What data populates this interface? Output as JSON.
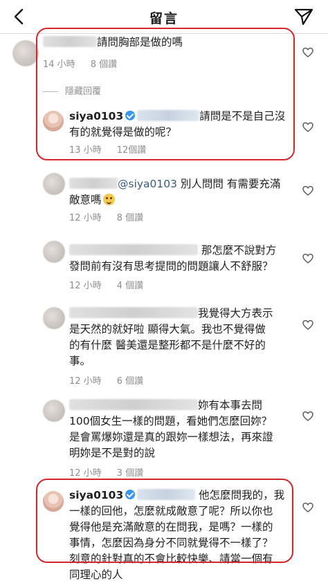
{
  "header": {
    "title": "留言"
  },
  "comments": [
    {
      "text": "請問胸部是做的嗎",
      "time": "14 小時",
      "likes": "8 個讚"
    },
    {
      "hidden_replies": "隱藏回覆"
    },
    {
      "username": "siya0103",
      "text_line1": "請問是不是自己沒",
      "text_line2": "有的就覺得是做的呢？",
      "time": "13 小時",
      "likes": "12個讚"
    },
    {
      "mention": "@siya0103",
      "text_line1": " 別人問問 有需要充滿",
      "text_line2": "敵意嗎",
      "time": "12 小時",
      "likes": "8 個讚"
    },
    {
      "text_line1": " 那怎麼不說對方",
      "text_line2": "發問前有沒有思考提問的問題讓人不舒服？",
      "time": "12 小時",
      "likes": "4 個讚"
    },
    {
      "text_line1": "我覺得大方表示",
      "text_line2": "是天然的就好啦 顯得大氣。我也不覺得做",
      "text_line3": "的有什麼 醫美還是整形都不是什麼不好的",
      "text_line4": "事。",
      "time": "12 小時",
      "likes": "6 個讚"
    },
    {
      "text_line1": "妳有本事去問",
      "text_line2": "100個女生一樣的問題，看她們怎麼回妳？",
      "text_line3": "是會罵爆妳還是真的跟妳一樣想法，再來證",
      "text_line4": "明妳是不是對的說",
      "time": "12 小時",
      "likes": "3 個讚"
    },
    {
      "username": "siya0103",
      "text_line1": " 他怎麼問我的，我",
      "text_line2": "一樣的回他，怎麼就成敵意了呢？所以你也",
      "text_line3": "覺得他是充滿敵意的在問我，是嗎？一樣的",
      "text_line4": "事情，怎麼因為身分不同就覺得不一樣了？",
      "text_line5": "刻意的針對真的不會比較快樂、請當一個有",
      "text_line6": "同理心的人"
    }
  ],
  "colors": {
    "highlight": "#d8242b",
    "mention": "#3a5a88",
    "verified": "#3897f0"
  },
  "icons": [
    "back-arrow-icon",
    "send-icon",
    "heart-icon",
    "verified-badge-icon",
    "smile-emoji-icon"
  ]
}
